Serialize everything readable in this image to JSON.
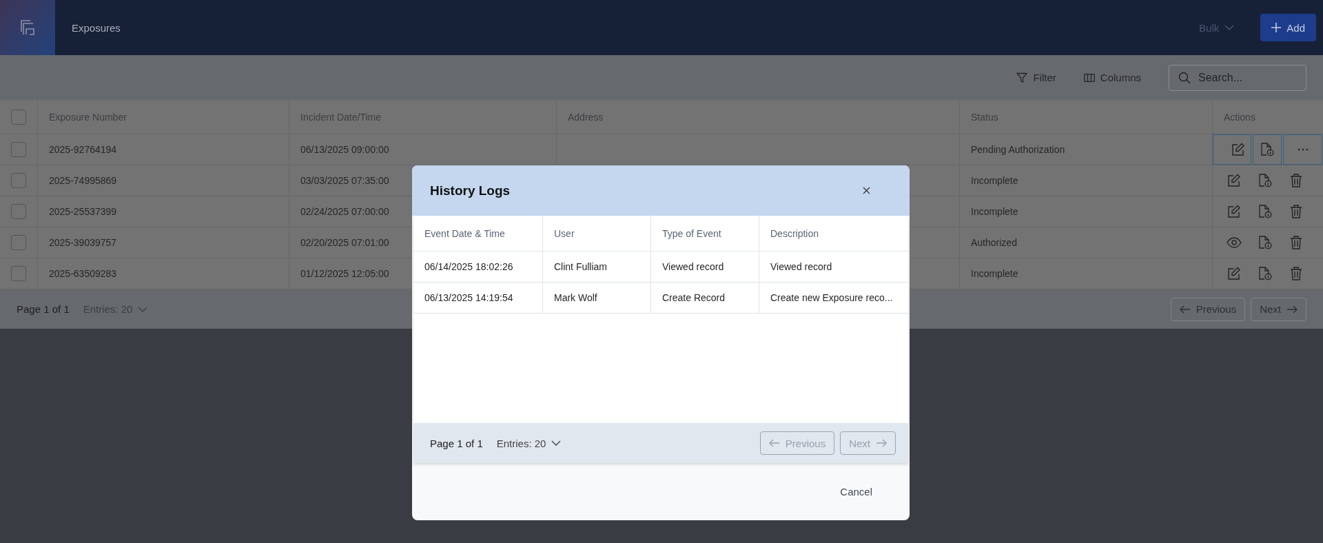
{
  "header": {
    "title": "Exposures",
    "bulk": {
      "label": "Bulk",
      "disabled": true
    },
    "add_button": "Add"
  },
  "toolbar": {
    "filter": "Filter",
    "columns": "Columns",
    "search": {
      "placeholder": "Search..."
    }
  },
  "table": {
    "select_all_checked": false,
    "columns": [
      "Exposure Number",
      "Incident Date/Time",
      "Address",
      "Status",
      "Actions"
    ],
    "rows": [
      {
        "cells": [
          "2025-92764194",
          "06/13/2025 09:00:00",
          "",
          "Pending Authorization"
        ],
        "checked": false,
        "selected": true,
        "actions": [
          {
            "kind": "edit"
          },
          {
            "kind": "info"
          },
          {
            "kind": "more"
          }
        ]
      },
      {
        "cells": [
          "2025-74995869",
          "03/03/2025 07:35:00",
          "",
          "Incomplete"
        ],
        "checked": false,
        "selected": false,
        "actions": [
          {
            "kind": "edit"
          },
          {
            "kind": "info"
          },
          {
            "kind": "delete"
          }
        ]
      },
      {
        "cells": [
          "2025-25537399",
          "02/24/2025 07:00:00",
          "",
          "Incomplete"
        ],
        "checked": false,
        "selected": false,
        "actions": [
          {
            "kind": "edit"
          },
          {
            "kind": "info"
          },
          {
            "kind": "delete"
          }
        ]
      },
      {
        "cells": [
          "2025-39039757",
          "02/20/2025 07:01:00",
          "",
          "Authorized"
        ],
        "checked": false,
        "selected": false,
        "actions": [
          {
            "kind": "view"
          },
          {
            "kind": "info"
          },
          {
            "kind": "delete"
          }
        ]
      },
      {
        "cells": [
          "2025-63509283",
          "01/12/2025 12:05:00",
          "",
          "Incomplete"
        ],
        "checked": false,
        "selected": false,
        "actions": [
          {
            "kind": "edit"
          },
          {
            "kind": "info"
          },
          {
            "kind": "delete"
          }
        ]
      }
    ]
  },
  "pagination": {
    "page": "Page 1 of 1",
    "entries": "Entries: 20",
    "previous": {
      "label": "Previous",
      "disabled": true
    },
    "next": {
      "label": "Next",
      "disabled": true
    }
  },
  "dialog": {
    "title": "History Logs",
    "columns": [
      "Event Date & Time",
      "User",
      "Type of Event",
      "Description"
    ],
    "rows": [
      [
        "06/14/2025 18:02:26",
        "Clint Fulliam",
        "Viewed record",
        "Viewed record"
      ],
      [
        "06/13/2025 14:19:54",
        "Mark Wolf",
        "Create Record",
        "Create new Exposure reco..."
      ]
    ],
    "pagination": {
      "page": "Page 1 of 1",
      "entries": "Entries: 20",
      "previous": {
        "label": "Previous",
        "disabled": true
      },
      "next": {
        "label": "Next",
        "disabled": true
      }
    },
    "cancel": "Cancel"
  }
}
